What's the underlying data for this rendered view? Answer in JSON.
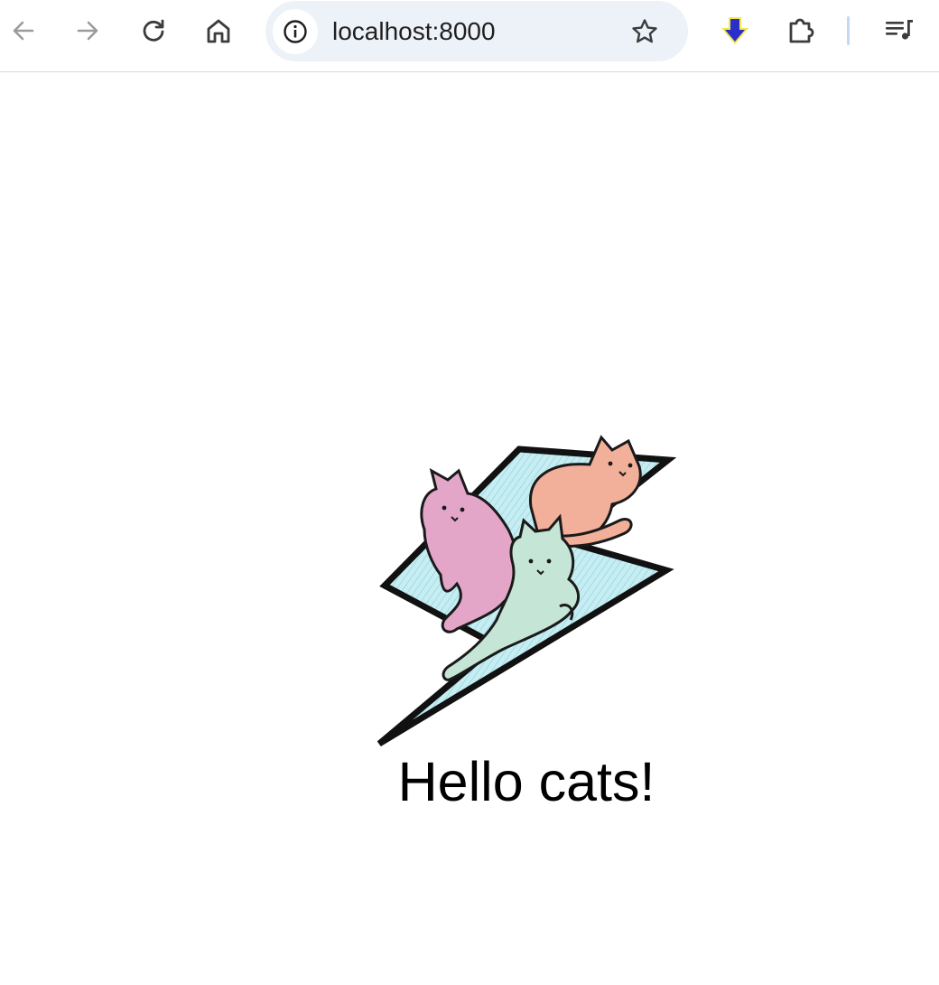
{
  "browser": {
    "url": "localhost:8000",
    "icons": {
      "back": "arrow-left-icon",
      "forward": "arrow-right-icon",
      "reload": "reload-icon",
      "home": "home-icon",
      "site_info": "info-icon",
      "bookmark": "star-icon",
      "extension_download": "download-arrow-icon",
      "extensions": "puzzle-icon",
      "media": "playlist-icon"
    }
  },
  "page": {
    "heading": "Hello cats!"
  },
  "colors": {
    "toolbar_bg": "#ffffff",
    "omnibox_bg": "#edf1f8",
    "text": "#000000",
    "download_icon": "#2b2fc9",
    "download_glow": "#f5e84a",
    "bolt_fill": "#bfeaf0",
    "cat_orange": "#f2b09a",
    "cat_pink": "#e3a6c8",
    "cat_mint": "#c5e6d6"
  }
}
